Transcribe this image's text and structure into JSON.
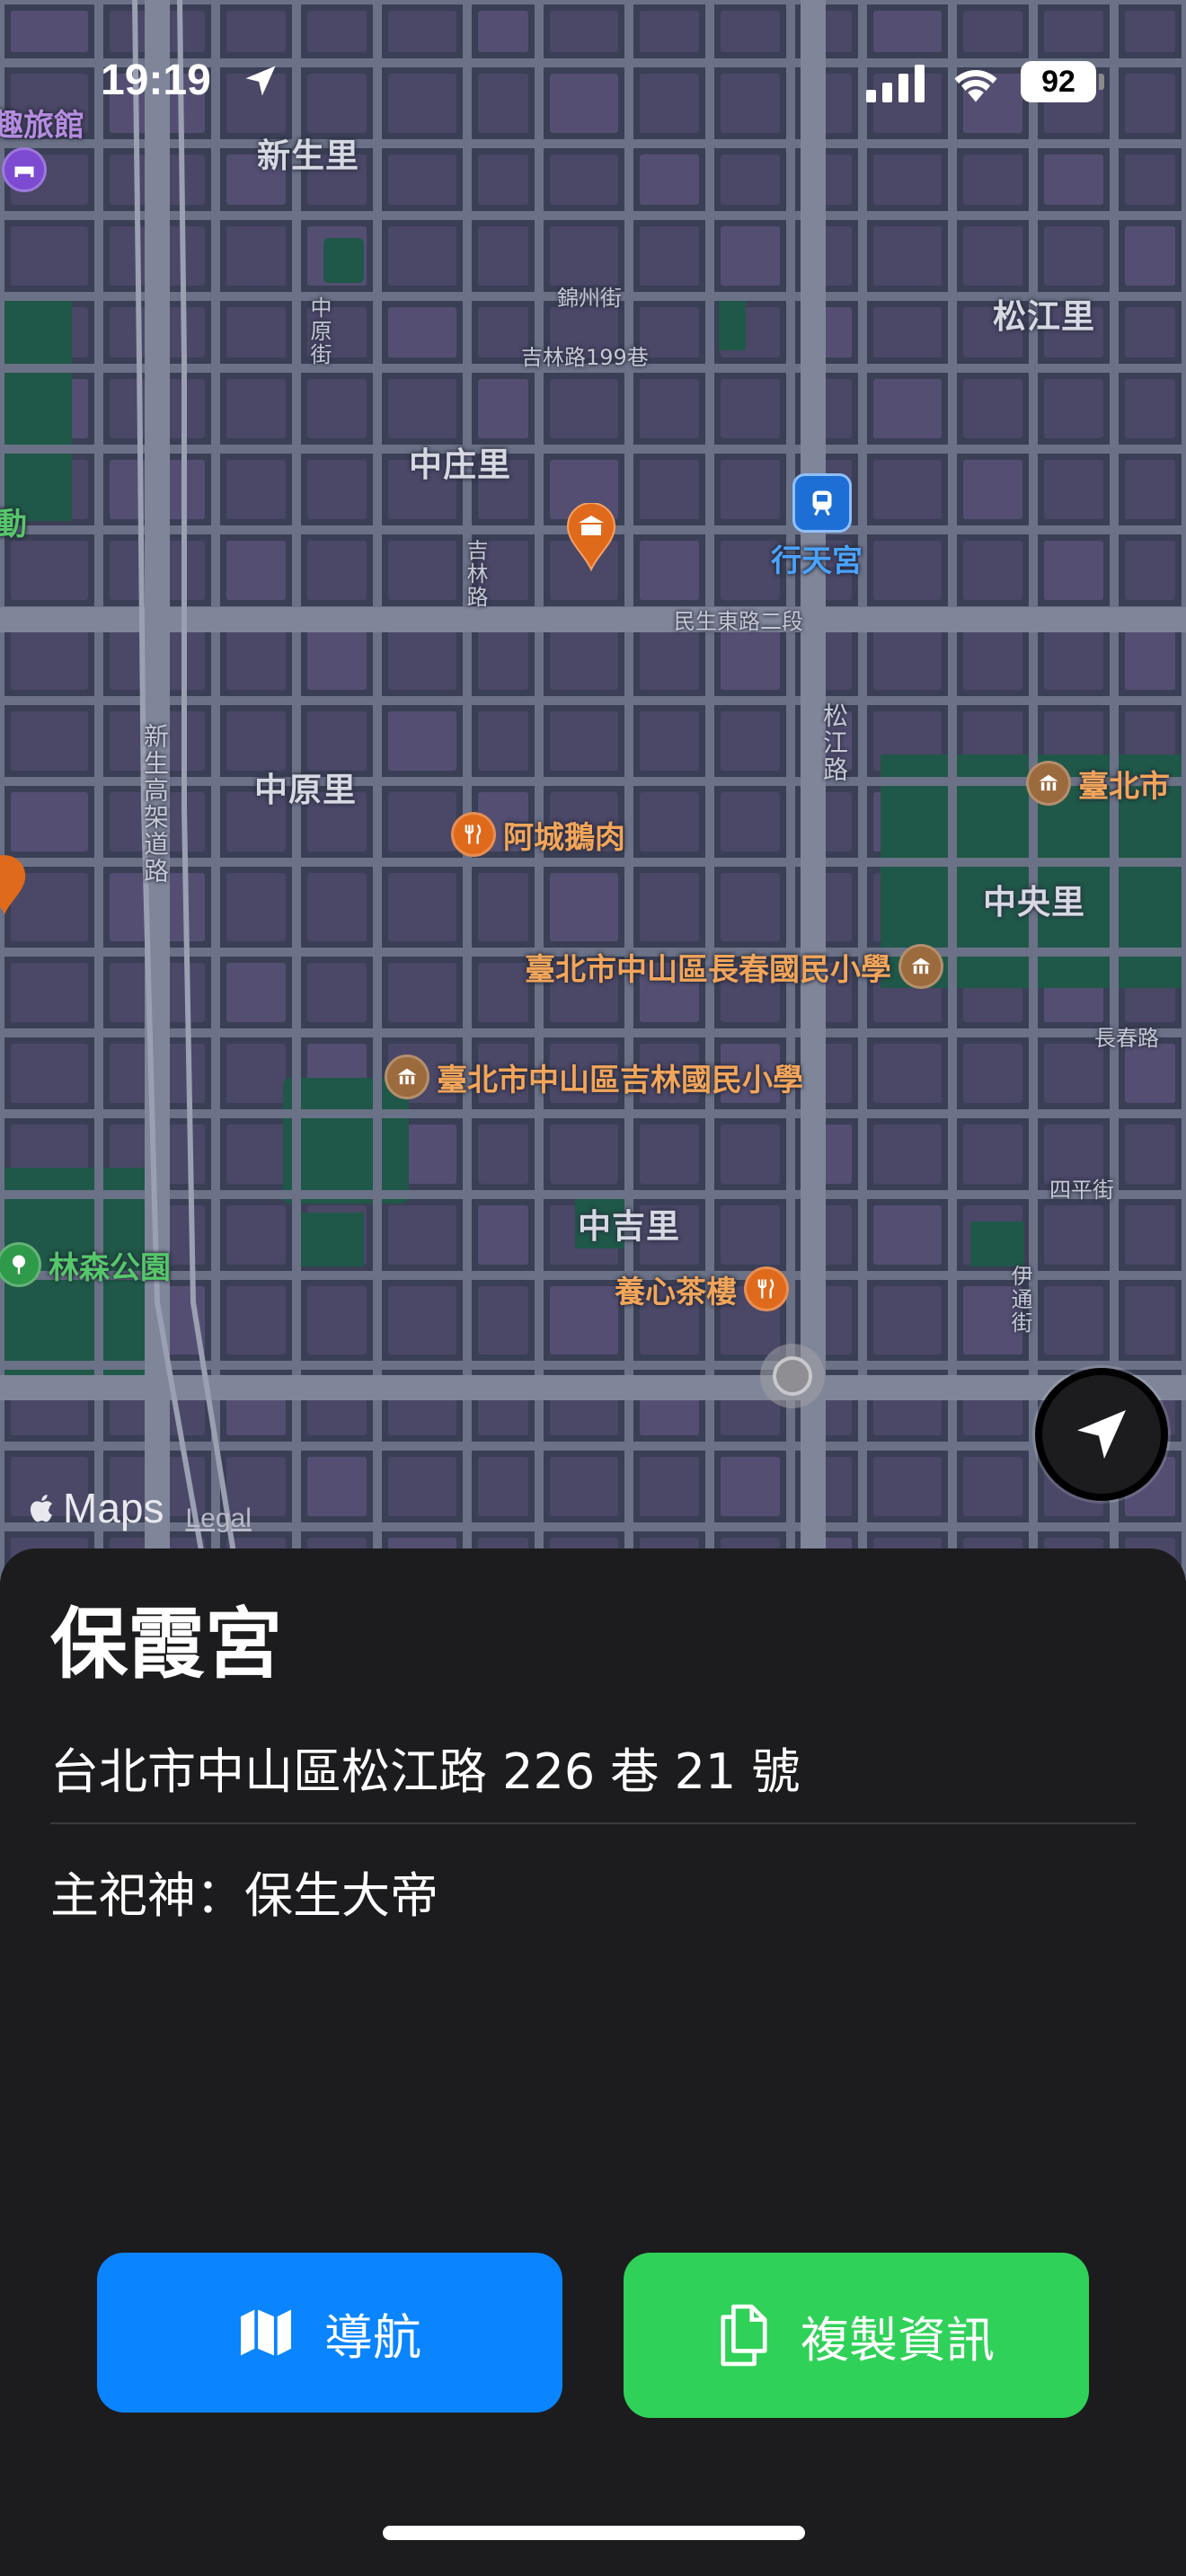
{
  "status_bar": {
    "time": "19:19",
    "battery": "92",
    "location_icon": "location-arrow-icon",
    "signal_icon": "cellular-signal-icon",
    "wifi_icon": "wifi-icon"
  },
  "map": {
    "district_labels": [
      "新生里",
      "松江里",
      "中庄里",
      "中原里",
      "中央里",
      "中吉里"
    ],
    "street_labels": [
      "錦州街",
      "吉林路199巷",
      "中原街",
      "吉林路",
      "民生東路二段",
      "松江路",
      "新生高架道路",
      "長春路",
      "四平街",
      "伊通街"
    ],
    "pois": {
      "hotel": "趣旅館",
      "station": "行天宮",
      "restaurant_1": "阿城鵝肉",
      "school_1": "臺北市中山區長春國民小學",
      "school_2": "臺北市中山區吉林國民小學",
      "park": "林森公園",
      "restaurant_2": "養心茶樓",
      "edge_school": "臺北市",
      "edge_left": "動"
    },
    "attribution": {
      "brand": "Maps",
      "legal": "Legal"
    },
    "colors": {
      "base": "#3a3f55",
      "block": "#4b4767",
      "road": "#6b7186",
      "park": "#1f5848",
      "accent_orange": "#e06a1b"
    }
  },
  "sheet": {
    "title": "保霞宮",
    "address": "台北市中山區松江路 226 巷 21 號",
    "deity": "主祀神：保生大帝",
    "nav_button_label": "導航",
    "copy_button_label": "複製資訊",
    "nav_icon": "map-icon",
    "copy_icon": "copy-documents-icon",
    "nav_color": "#0a84ff",
    "copy_color": "#30d158"
  }
}
